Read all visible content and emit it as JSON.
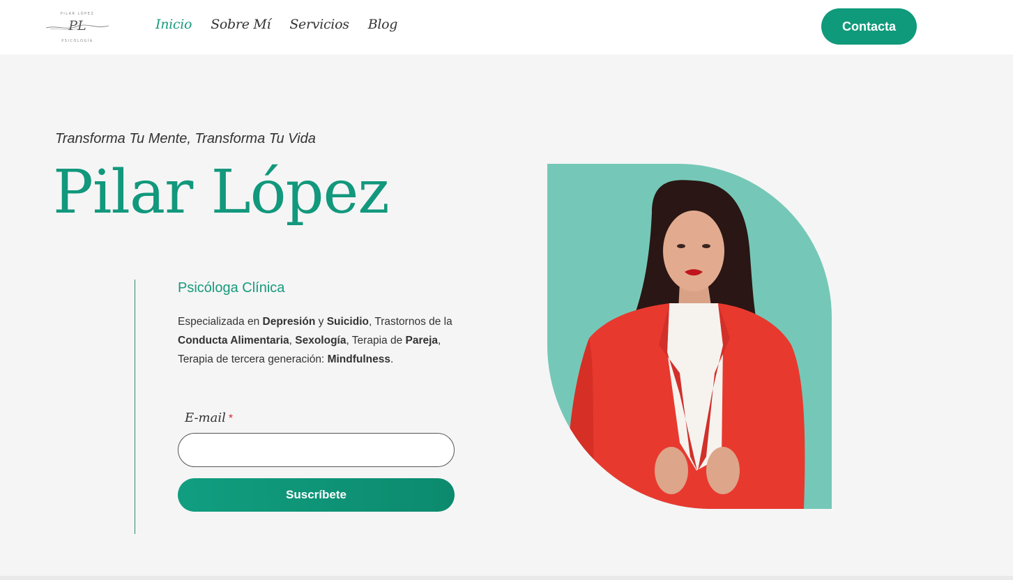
{
  "header": {
    "logo": {
      "top_text": "PILAR LÓPEZ",
      "monogram": "PL",
      "bottom_text": "PSICOLOGÍA"
    },
    "nav": [
      {
        "label": "Inicio",
        "active": true
      },
      {
        "label": "Sobre Mí",
        "active": false
      },
      {
        "label": "Servicios",
        "active": false
      },
      {
        "label": "Blog",
        "active": false
      }
    ],
    "contact_label": "Contacta"
  },
  "hero": {
    "tagline": "Transforma Tu Mente, Transforma Tu Vida",
    "name": "Pilar López",
    "subtitle": "Psicóloga Clínica",
    "description": {
      "t1": "Especializada en ",
      "b1": "Depresión",
      "t2": " y ",
      "b2": "Suicidio",
      "t3": ", Trastornos de la ",
      "b3": "Conducta Alimentaria",
      "t4": ", ",
      "b4": "Sexología",
      "t5": ", Terapia de ",
      "b5": "Pareja",
      "t6": ", Terapia de tercera generación: ",
      "b6": "Mindfulness",
      "t7": "."
    }
  },
  "form": {
    "email_label": "E-mail",
    "required_mark": "*",
    "email_value": "",
    "subscribe_label": "Suscríbete"
  },
  "colors": {
    "accent": "#0f9a7b",
    "photo_bg": "#75c8b7",
    "jacket": "#e8392f",
    "page_bg": "#f5f5f5"
  }
}
